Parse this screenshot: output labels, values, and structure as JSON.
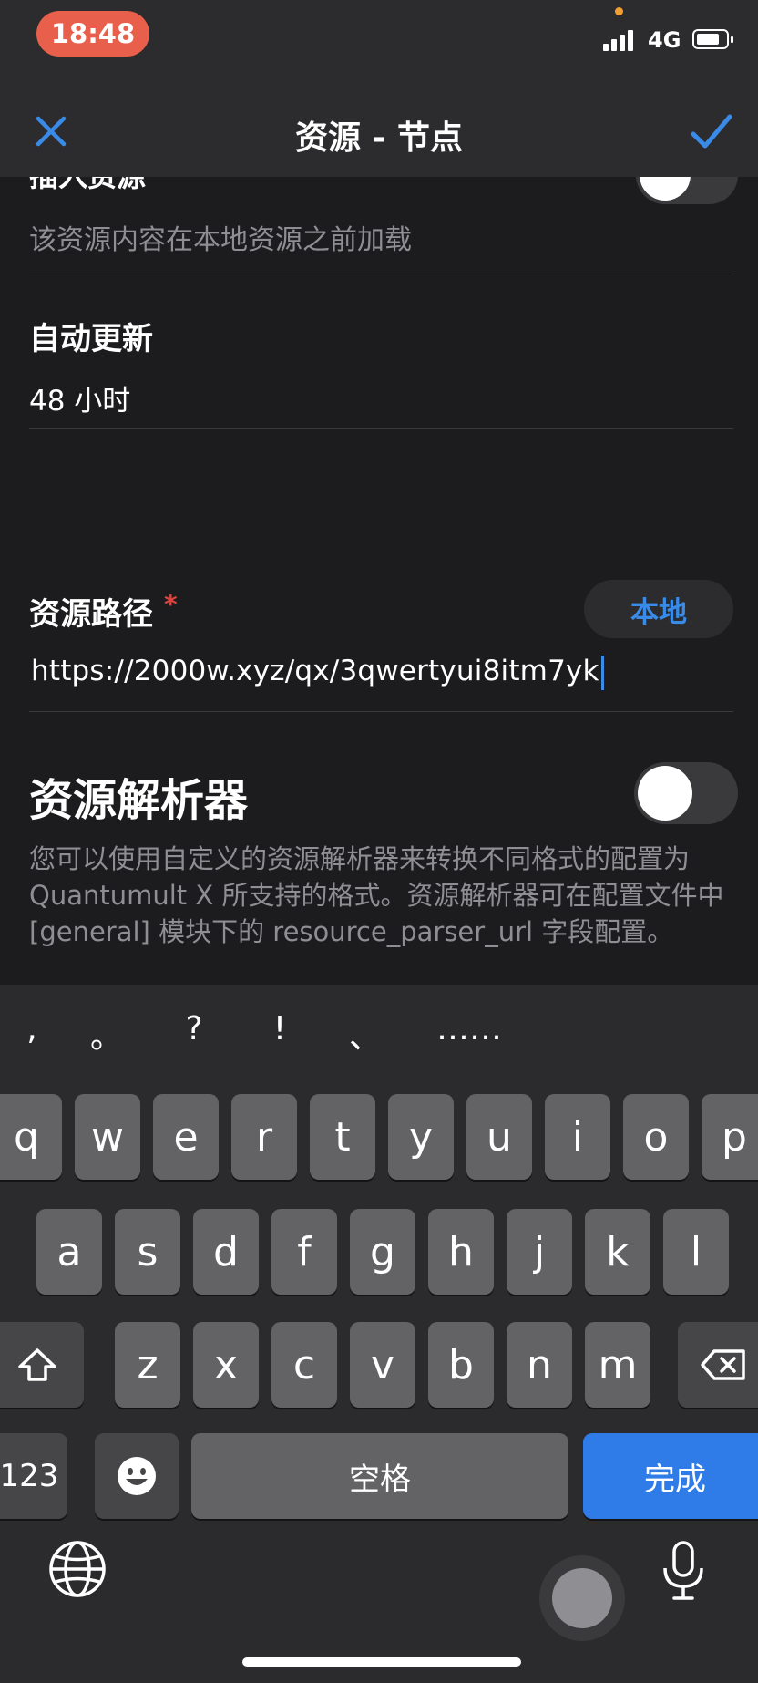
{
  "status_bar": {
    "time": "18:48",
    "network": "4G"
  },
  "nav": {
    "title": "资源 - 节点",
    "close_icon": "close-icon",
    "confirm_icon": "checkmark-icon"
  },
  "sections": {
    "prepend": {
      "title": "插入资源",
      "description": "该资源内容在本地资源之前加载",
      "toggle_on": false
    },
    "auto_update": {
      "label": "自动更新",
      "value": "48 小时"
    },
    "resource_path": {
      "label": "资源路径",
      "required_mark": "*",
      "local_button": "本地",
      "value": "https://2000w.xyz/qx/3qwertyui8itm7yk"
    },
    "parser": {
      "title": "资源解析器",
      "toggle_on": false,
      "description": "您可以使用自定义的资源解析器来转换不同格式的配置为 Quantumult X 所支持的格式。资源解析器可在配置文件中 [general] 模块下的 resource_parser_url 字段配置。"
    }
  },
  "keyboard": {
    "punctuation": [
      ",",
      "。",
      "?",
      "!",
      "、",
      "……"
    ],
    "row1": [
      "q",
      "w",
      "e",
      "r",
      "t",
      "y",
      "u",
      "i",
      "o",
      "p"
    ],
    "row2": [
      "a",
      "s",
      "d",
      "f",
      "g",
      "h",
      "j",
      "k",
      "l"
    ],
    "row3": [
      "z",
      "x",
      "c",
      "v",
      "b",
      "n",
      "m"
    ],
    "num_key": "123",
    "space": "空格",
    "done": "完成",
    "accent_color": "#2f7ce8"
  }
}
